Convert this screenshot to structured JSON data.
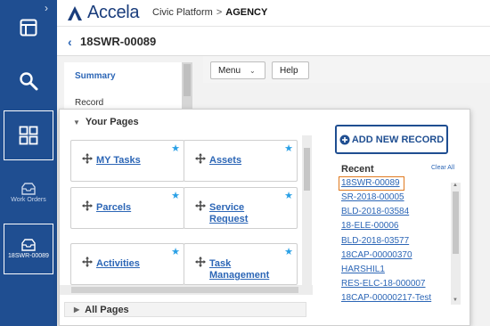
{
  "app": {
    "brand": "Accela",
    "breadcrumb_root": "Civic Platform",
    "breadcrumb_sep": ">",
    "breadcrumb_current": "AGENCY"
  },
  "record": {
    "id": "18SWR-00089"
  },
  "rail": {
    "collapse_icon": "chevron-right",
    "work_orders_label": "Work Orders",
    "active_record_label": "18SWR-00089"
  },
  "left_nav": {
    "summary": "Summary",
    "record": "Record"
  },
  "toolbar": {
    "menu_label": "Menu",
    "help_label": "Help"
  },
  "your_pages": {
    "heading": "Your Pages",
    "items": [
      {
        "label": "MY Tasks"
      },
      {
        "label": "Assets"
      },
      {
        "label": "Parcels"
      },
      {
        "label": "Service Request"
      },
      {
        "label": "Activities"
      },
      {
        "label": "Task Management"
      }
    ]
  },
  "all_pages": {
    "heading": "All Pages"
  },
  "recent": {
    "add_new_label": "ADD NEW RECORD",
    "heading": "Recent",
    "clear_all": "Clear All",
    "items": [
      "18SWR-00089",
      "SR-2018-00005",
      "BLD-2018-03584",
      "18-ELE-00006",
      "BLD-2018-03577",
      "18CAP-00000370",
      "HARSHIL1",
      "RES-ELC-18-000007",
      "18CAP-00000217-Test"
    ]
  },
  "colors": {
    "rail": "#1f4e91",
    "link": "#2c66b6",
    "star": "#2aa0e6",
    "selected_border": "#e07a1f"
  }
}
